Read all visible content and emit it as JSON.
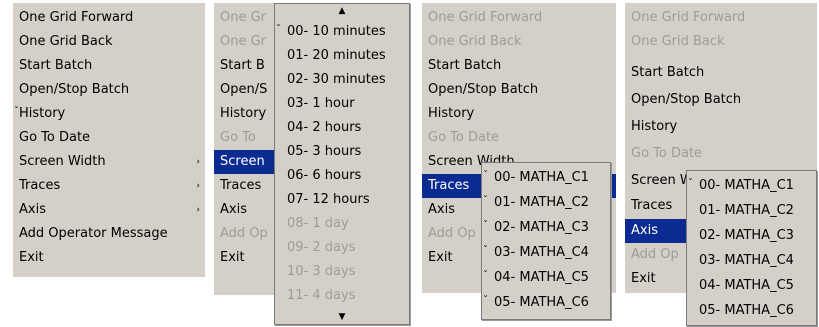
{
  "panel1": {
    "items": [
      {
        "label": "One Grid Forward"
      },
      {
        "label": "One Grid Back"
      },
      {
        "label": "Start Batch"
      },
      {
        "label": "Open/Stop Batch"
      },
      {
        "label": "History",
        "tick": "ˇ"
      },
      {
        "label": "Go To Date"
      },
      {
        "label": "Screen Width"
      },
      {
        "label": "Traces"
      },
      {
        "label": "Axis"
      },
      {
        "label": "Add Operator Message"
      },
      {
        "label": "Exit"
      }
    ]
  },
  "panel2": {
    "items": [
      {
        "label": "One Gr"
      },
      {
        "label": "One Gr"
      },
      {
        "label": "Start B"
      },
      {
        "label": "Open/S"
      },
      {
        "label": "History"
      },
      {
        "label": "Go To"
      },
      {
        "label": "Screen"
      },
      {
        "label": "Traces"
      },
      {
        "label": "Axis"
      },
      {
        "label": "Add Op"
      },
      {
        "label": "Exit"
      }
    ],
    "submenu": {
      "scroll_up": "▲",
      "scroll_down": "▼",
      "items": [
        {
          "label": "00- 10 minutes",
          "tick": "ˇ"
        },
        {
          "label": "01- 20 minutes"
        },
        {
          "label": "02- 30 minutes"
        },
        {
          "label": "03- 1 hour"
        },
        {
          "label": "04- 2 hours"
        },
        {
          "label": "05- 3 hours"
        },
        {
          "label": "06- 6 hours"
        },
        {
          "label": "07- 12 hours"
        },
        {
          "label": "08- 1 day"
        },
        {
          "label": "09- 2 days"
        },
        {
          "label": "10- 3 days"
        },
        {
          "label": "11- 4 days"
        }
      ]
    }
  },
  "panel3": {
    "items": [
      {
        "label": "One Grid Forward"
      },
      {
        "label": "One Grid Back"
      },
      {
        "label": "Start Batch"
      },
      {
        "label": "Open/Stop Batch"
      },
      {
        "label": "History"
      },
      {
        "label": "Go To Date"
      },
      {
        "label": "Screen Width"
      },
      {
        "label": "Traces"
      },
      {
        "label": "Axis"
      },
      {
        "label": "Add Op"
      },
      {
        "label": "Exit"
      }
    ],
    "submenu": {
      "items": [
        {
          "label": "00- MATHA_C1",
          "tick": "ˇ"
        },
        {
          "label": "01- MATHA_C2",
          "tick": "ˇ"
        },
        {
          "label": "02- MATHA_C3",
          "tick": "ˇ"
        },
        {
          "label": "03- MATHA_C4",
          "tick": "ˇ"
        },
        {
          "label": "04- MATHA_C5",
          "tick": "ˇ"
        },
        {
          "label": "05- MATHA_C6",
          "tick": "ˇ"
        }
      ]
    }
  },
  "panel4": {
    "items": [
      {
        "label": "One Grid Forward"
      },
      {
        "label": "One Grid Back"
      },
      {
        "label": "Start Batch"
      },
      {
        "label": "Open/Stop Batch"
      },
      {
        "label": "History"
      },
      {
        "label": "Go To Date"
      },
      {
        "label": "Screen Width"
      },
      {
        "label": "Traces"
      },
      {
        "label": "Axis"
      },
      {
        "label": "Add Op"
      },
      {
        "label": "Exit"
      }
    ],
    "submenu": {
      "items": [
        {
          "label": "00- MATHA_C1",
          "tick": "ˇ"
        },
        {
          "label": "01- MATHA_C2"
        },
        {
          "label": "02- MATHA_C3"
        },
        {
          "label": "03- MATHA_C4"
        },
        {
          "label": "04- MATHA_C5"
        },
        {
          "label": "05- MATHA_C6"
        }
      ]
    }
  },
  "icons": {
    "submenu_arrow": "›"
  },
  "colors": {
    "menu_bg": "#d4d0c8",
    "highlight": "#0b2a92",
    "disabled": "#9f9c95"
  }
}
